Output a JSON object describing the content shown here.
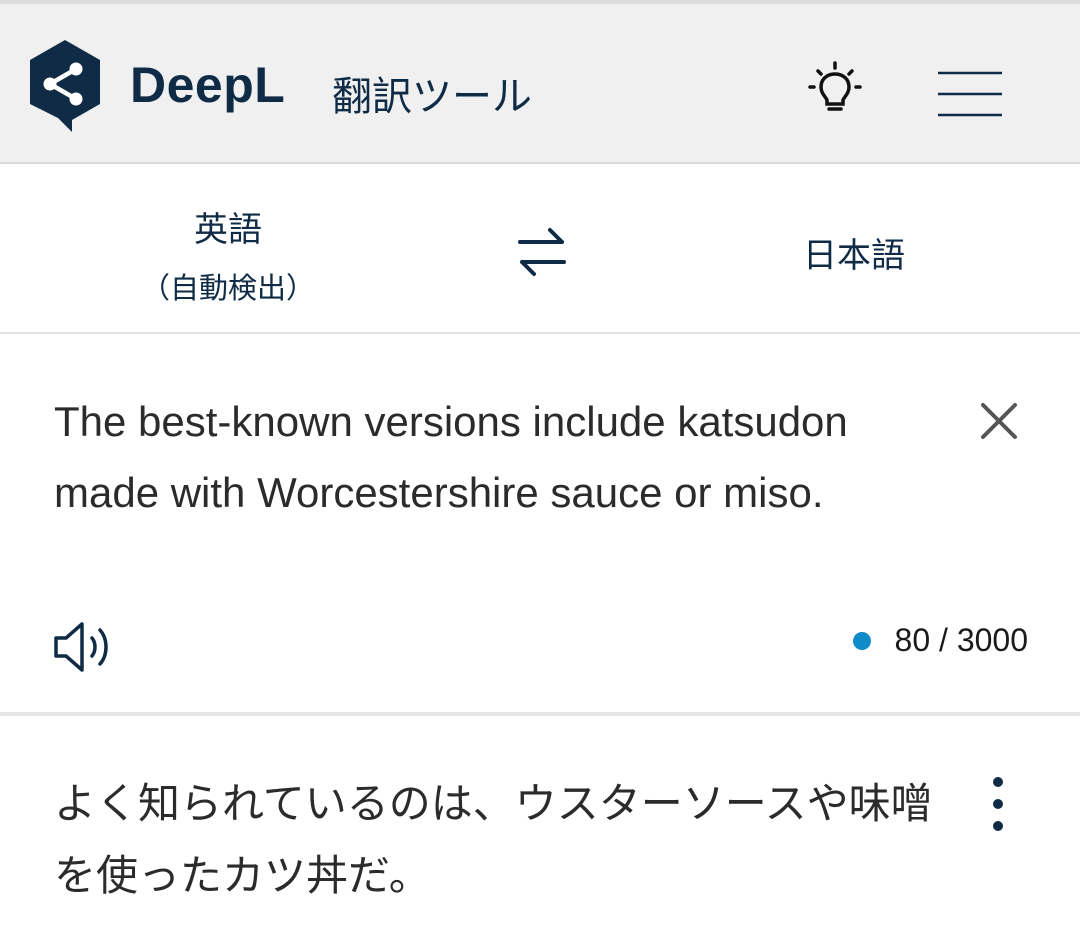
{
  "header": {
    "brand": "DeepL",
    "tool_title": "翻訳ツール",
    "logo_icon": "deepl-share-logo-icon",
    "tips_icon": "lightbulb-icon",
    "menu_icon": "hamburger-menu-icon"
  },
  "languages": {
    "source_label": "英語",
    "source_detect": "（自動検出）",
    "swap_icon": "swap-arrows-icon",
    "target_label": "日本語"
  },
  "source": {
    "text": "The best-known versions include katsudon made with Worcestershire sauce or miso.",
    "clear_icon": "close-icon",
    "speaker_icon": "speaker-icon",
    "char_count": "80 / 3000",
    "status_color": "#0f8bc9"
  },
  "target": {
    "text": "よく知られているのは、ウスターソースや味噌を使ったカツ丼だ。",
    "more_icon": "more-vertical-icon"
  },
  "colors": {
    "brand": "#0f2b46",
    "header_bg": "#f0f0f0"
  }
}
